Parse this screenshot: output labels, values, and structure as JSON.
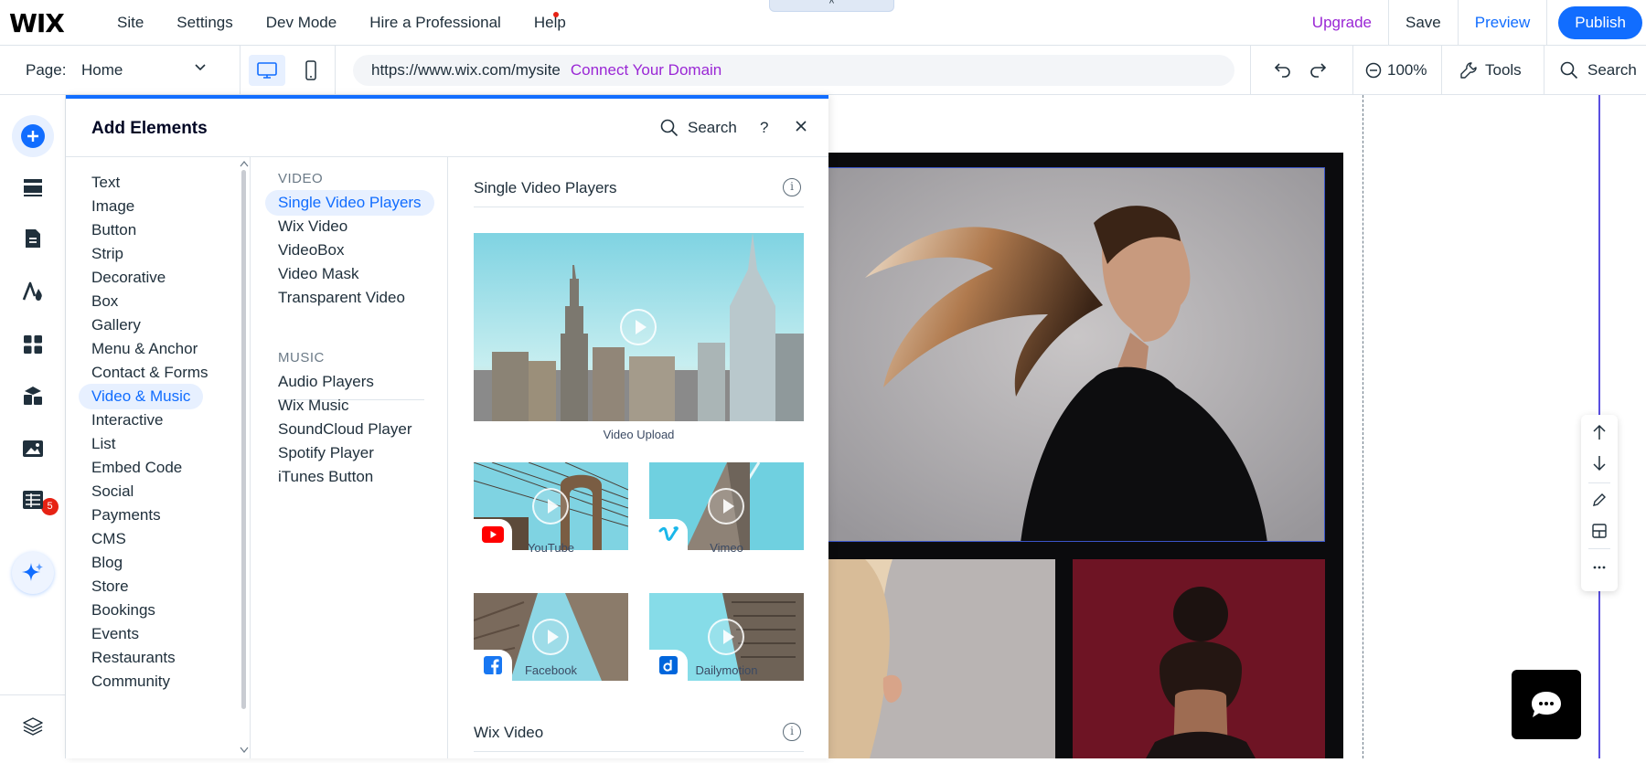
{
  "topbar": {
    "logo": "WIX",
    "nav": [
      "Site",
      "Settings",
      "Dev Mode",
      "Hire a Professional",
      "Help"
    ],
    "upgrade": "Upgrade",
    "save": "Save",
    "preview": "Preview",
    "publish": "Publish",
    "collapse_glyph": "^"
  },
  "toolbar": {
    "page_label": "Page:",
    "page_value": "Home",
    "url": "https://www.wix.com/mysite",
    "connect_domain": "Connect Your Domain",
    "zoom": "100%",
    "tools": "Tools",
    "search": "Search"
  },
  "rail": {
    "badge_count": "5",
    "icons": [
      "add-elements-icon",
      "sections-icon",
      "pages-icon",
      "design-icon",
      "apps-icon",
      "business-apps-icon",
      "media-icon",
      "cms-table-icon",
      "ai-assistant-icon",
      "layers-icon"
    ]
  },
  "panel": {
    "title": "Add Elements",
    "search": "Search",
    "help": "?",
    "categories": [
      "Text",
      "Image",
      "Button",
      "Strip",
      "Decorative",
      "Box",
      "Gallery",
      "Menu & Anchor",
      "Contact & Forms",
      "Video & Music",
      "Interactive",
      "List",
      "Embed Code",
      "Social",
      "Payments",
      "CMS",
      "Blog",
      "Store",
      "Bookings",
      "Events",
      "Restaurants",
      "Community"
    ],
    "active_category": "Video & Music",
    "video_heading": "VIDEO",
    "video_items": [
      "Single Video Players",
      "Wix Video",
      "VideoBox",
      "Video Mask",
      "Transparent Video"
    ],
    "music_heading": "MUSIC",
    "music_items": [
      "Audio Players",
      "Wix Music",
      "SoundCloud Player",
      "Spotify Player",
      "iTunes Button"
    ],
    "section1_title": "Single Video Players",
    "section2_title": "Wix Video",
    "players": {
      "upload": "Video Upload",
      "youtube": "YouTube",
      "vimeo": "Vimeo",
      "facebook": "Facebook",
      "dailymotion": "Dailymotion"
    }
  },
  "colors": {
    "accent": "#116dff",
    "upgrade": "#9a27d5",
    "badge": "#e62214",
    "active_bg": "#e7f0ff"
  }
}
